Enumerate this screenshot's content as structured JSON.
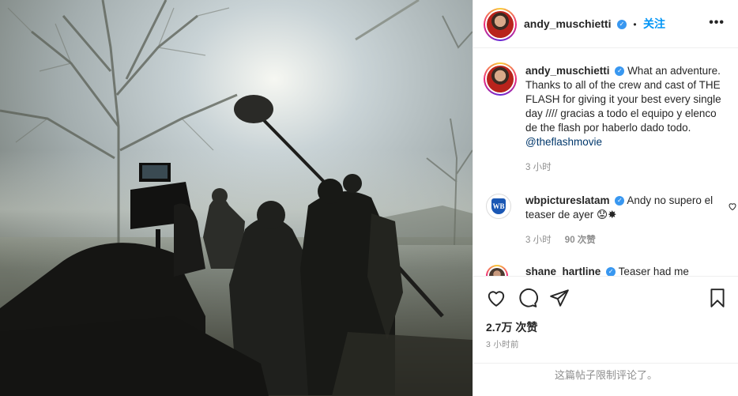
{
  "header": {
    "username": "andy_muschietti",
    "separator": "•",
    "follow_label": "关注",
    "more_label": "•••"
  },
  "caption": {
    "username": "andy_muschietti",
    "text": "What an adventure. Thanks to all of the crew and cast of THE FLASH for giving it your best every single day ////          gracias a todo el equipo y elenco de the flash por haberlo dado todo. ",
    "mention": "@theflashmovie",
    "time": "3 小时"
  },
  "comments": [
    {
      "username": "wbpictureslatam",
      "logo_text": "WB",
      "text": "Andy no supero el teaser de ayer 😟✸",
      "time": "3 小时",
      "likes": "90 次赞"
    },
    {
      "username": "shane_hartline",
      "text": "Teaser had me"
    }
  ],
  "actions": {
    "like_icon": "heart-icon",
    "comment_icon": "comment-icon",
    "share_icon": "paper-plane-icon",
    "save_icon": "bookmark-icon"
  },
  "likes_label": "2.7万 次赞",
  "time_ago": "3 小时前",
  "comments_limited": "这篇帖子限制评论了。",
  "colors": {
    "link": "#0095f6",
    "verified": "#3897f0",
    "muted": "#8e8e8e",
    "mention": "#00376b"
  }
}
